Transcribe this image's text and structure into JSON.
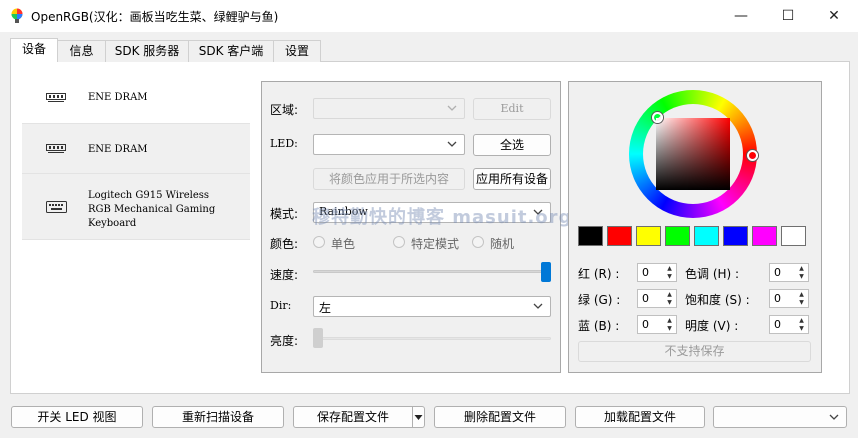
{
  "window": {
    "title": "OpenRGB(汉化：画板当吃生菜、绿鲤驴与鱼)",
    "minimize": "—",
    "maximize": "☐",
    "close": "✕"
  },
  "tabs": [
    "设备",
    "信息",
    "SDK 服务器",
    "SDK 客户端",
    "设置"
  ],
  "devices": [
    {
      "label": "ENE DRAM",
      "icon": "ram-icon"
    },
    {
      "label": "ENE DRAM",
      "icon": "ram-icon"
    },
    {
      "label_lines": [
        "Logitech G915 Wireless",
        "RGB Mechanical Gaming",
        "Keyboard"
      ],
      "icon": "keyboard-icon"
    }
  ],
  "controls": {
    "zone_label": "区域:",
    "zone_value": "",
    "edit_button": "Edit",
    "led_label": "LED:",
    "led_value": "",
    "select_all_button": "全选",
    "apply_selected_button": "将颜色应用于所选内容",
    "apply_all_button": "应用所有设备",
    "mode_label": "模式:",
    "mode_value": "Rainbow",
    "color_label": "颜色:",
    "color_options": [
      "单色",
      "特定模式",
      "随机"
    ],
    "speed_label": "速度:",
    "speed_value": 1.0,
    "dir_label": "Dir:",
    "dir_value": "左",
    "brightness_label": "亮度:",
    "brightness_value": 0.0
  },
  "color_picker": {
    "swatches": [
      "#000000",
      "#ff0000",
      "#ffff00",
      "#00ff00",
      "#00ffff",
      "#0000ff",
      "#ff00ff",
      "#ffffff"
    ],
    "red_label": "红 (R) :",
    "green_label": "绿 (G) :",
    "blue_label": "蓝 (B) :",
    "hue_label": "色调 (H) :",
    "saturation_label": "饱和度 (S) :",
    "value_label": "明度 (V) :",
    "red": "0",
    "green": "0",
    "blue": "0",
    "hue": "0",
    "saturation": "0",
    "value": "0",
    "save_button": "不支持保存"
  },
  "bottom": {
    "toggle_led_view": "开关 LED 视图",
    "rescan": "重新扫描设备",
    "save_profile": "保存配置文件",
    "delete_profile": "删除配置文件",
    "load_profile": "加载配置文件",
    "profile_value": ""
  },
  "watermark": "穆特勤快的博客 masuit.org",
  "colors": {
    "accent": "#0078d7"
  }
}
